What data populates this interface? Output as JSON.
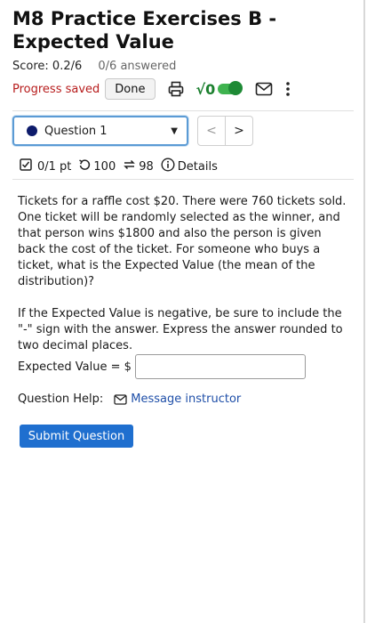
{
  "header": {
    "title": "M8 Practice Exercises B - Expected Value",
    "score": "Score: 0.2/6",
    "answered": "0/6 answered",
    "progress_status": "Progress saved",
    "done_label": "Done"
  },
  "toolbar": {
    "sqrt_label": "√0",
    "icons": [
      "printer-icon",
      "math-toggle",
      "mail-icon",
      "more-vertical-icon"
    ]
  },
  "question_nav": {
    "selected": "Question 1",
    "prev_label": "<",
    "next_label": ">"
  },
  "meta": {
    "points": "0/1 pt",
    "attempts": "100",
    "retries": "98",
    "details_label": "Details"
  },
  "question": {
    "paragraph1": "Tickets for a raffle cost $20. There were 760 tickets sold. One ticket will be randomly selected as the winner, and that person wins $1800 and also the person is given back the cost of the ticket. For someone who buys a ticket, what is the Expected Value (the mean of the distribution)?",
    "paragraph2": "If the Expected Value is negative, be sure to include the \"-\" sign with the answer. Express the answer rounded to two decimal places.",
    "answer_label": "Expected Value = $",
    "answer_value": ""
  },
  "help": {
    "label": "Question Help:",
    "link_label": "Message instructor"
  },
  "submit_label": "Submit Question",
  "colors": {
    "accent": "#1f6fcf",
    "saved": "#b71c1c",
    "toggle": "#3fb34f",
    "link": "#1f4fa8"
  }
}
